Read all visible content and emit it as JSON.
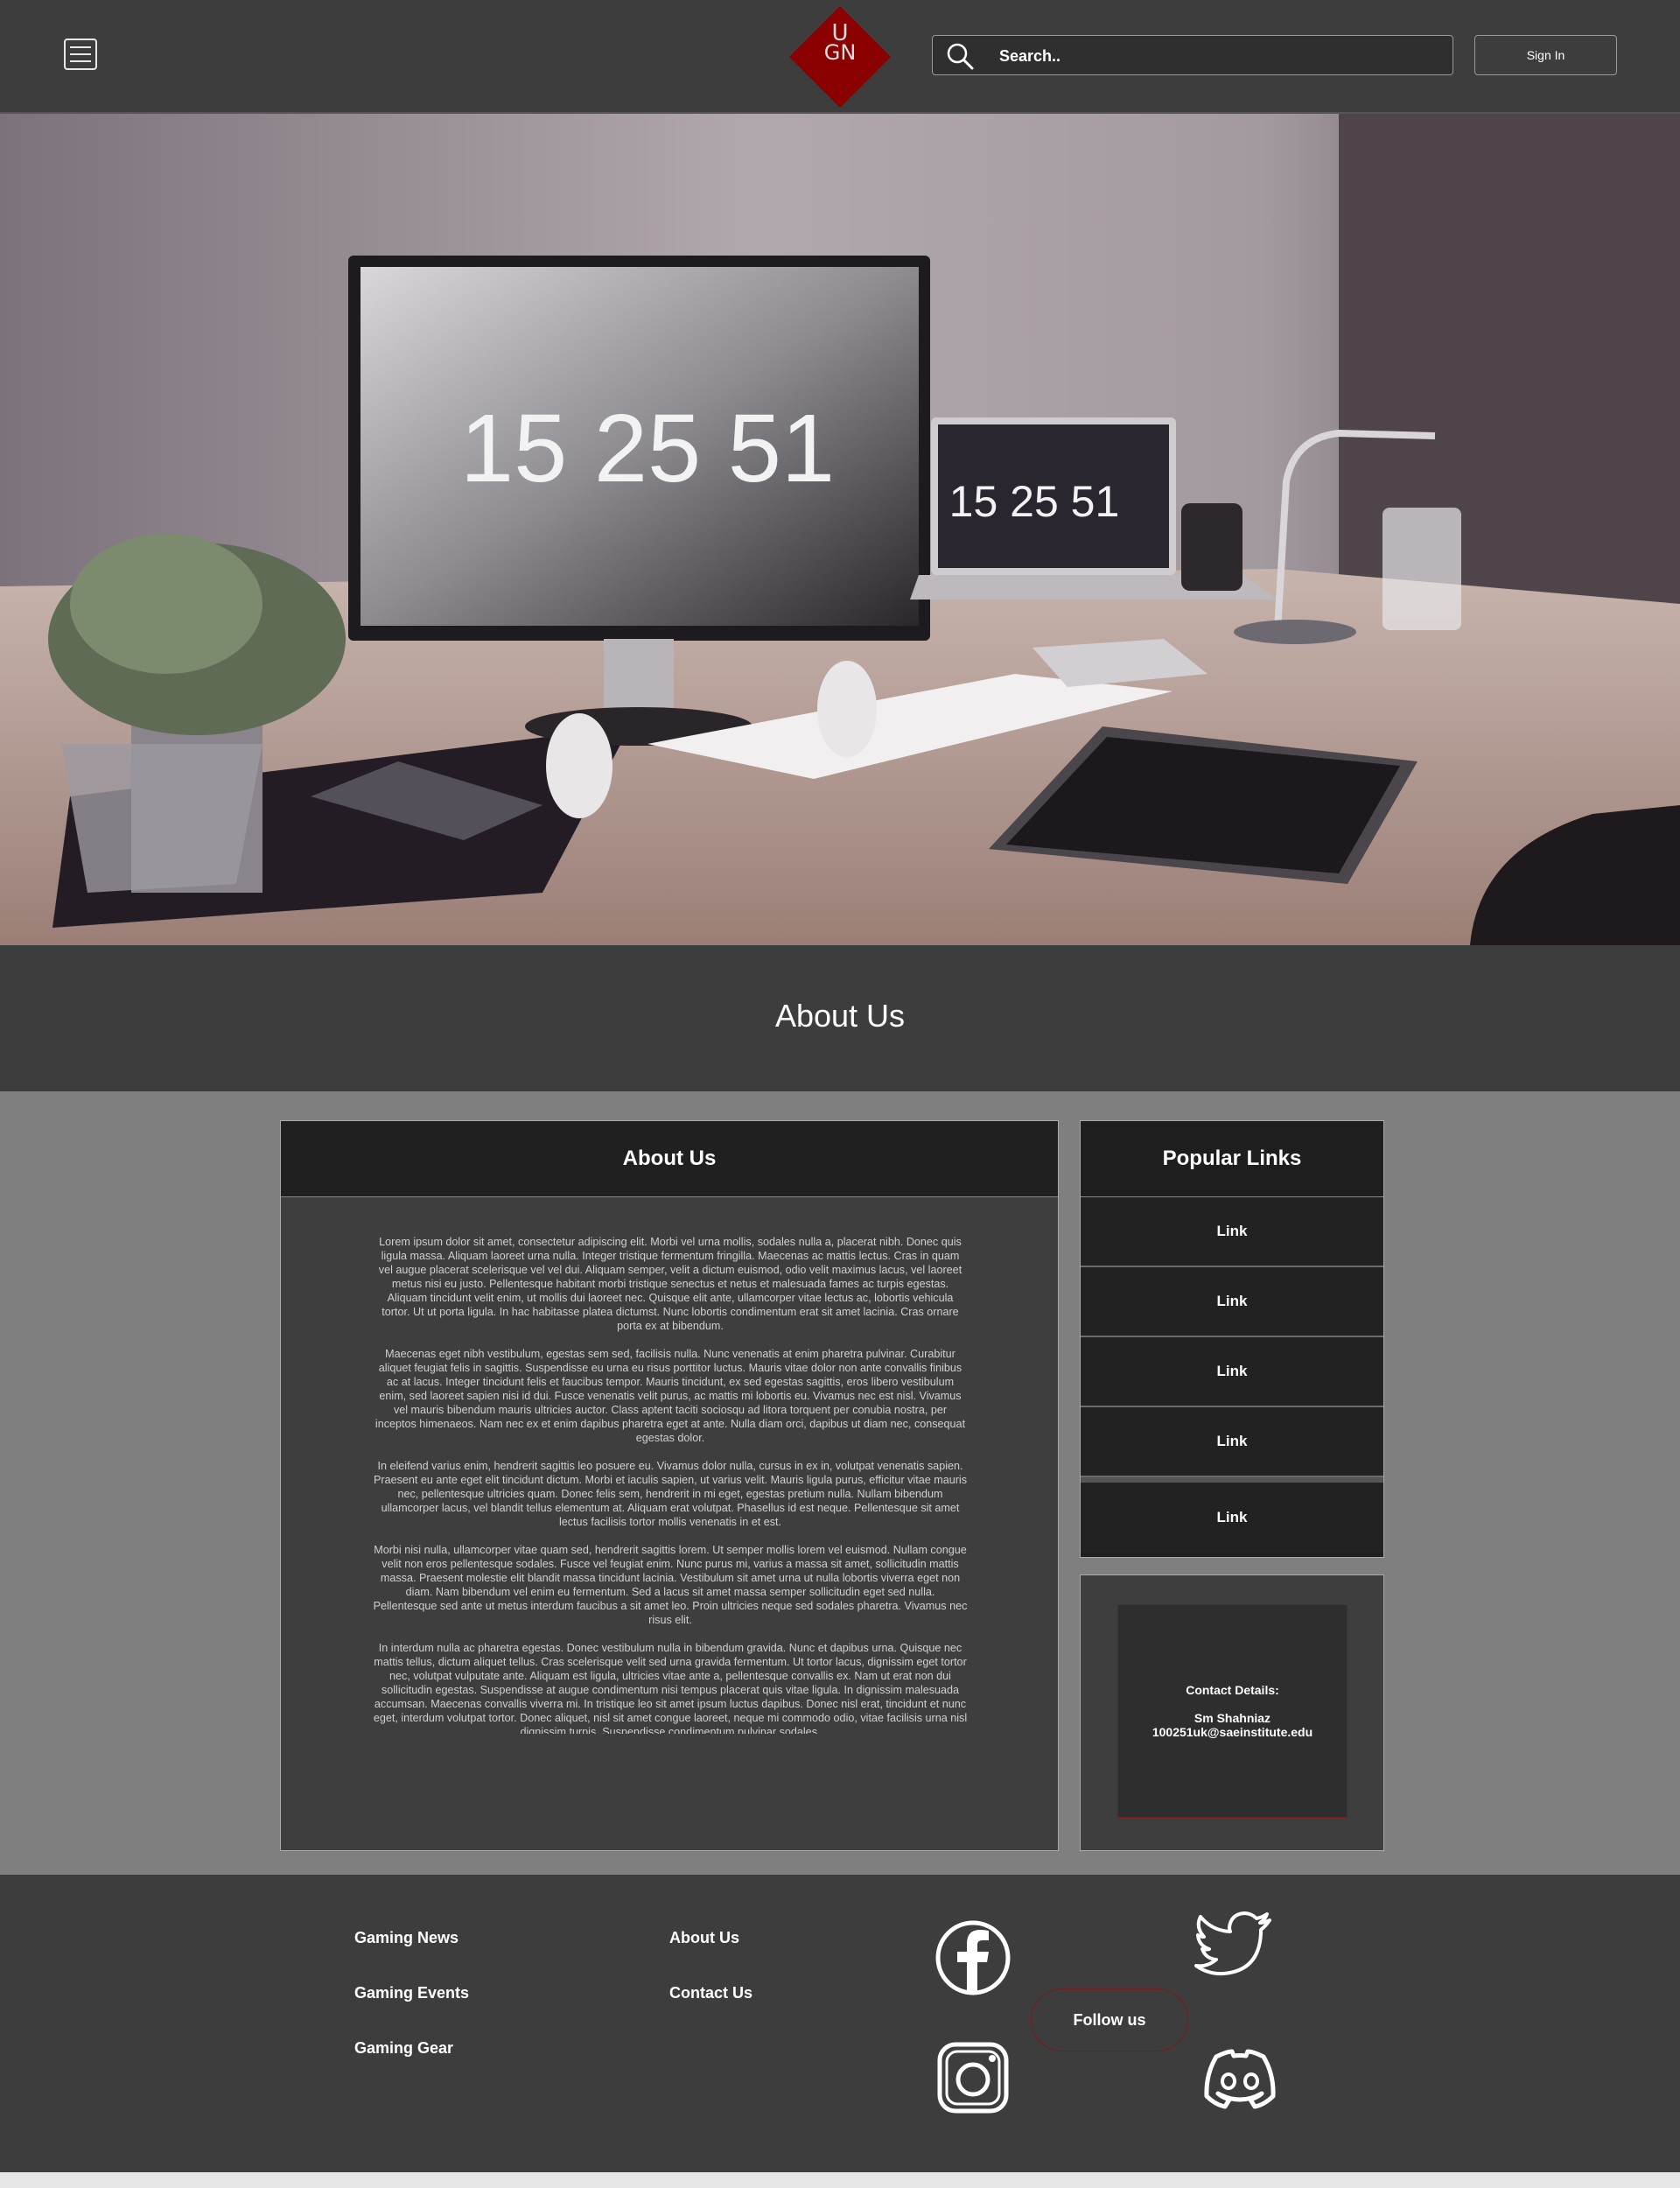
{
  "header": {
    "menu_icon": "hamburger-menu-icon",
    "logo": {
      "line1": "U",
      "line2": "GN",
      "color": "#8b0000"
    },
    "search": {
      "placeholder": "Search..",
      "icon": "search-icon"
    },
    "signin_label": "Sign In"
  },
  "hero": {
    "monitor_time": "15 25 51",
    "laptop_time": "15 25 51"
  },
  "about_band": {
    "title": "About Us"
  },
  "main_card": {
    "title": "About Us",
    "paragraphs": [
      "Lorem ipsum dolor sit amet, consectetur adipiscing elit. Morbi vel urna mollis, sodales nulla a, placerat nibh. Donec quis ligula massa. Aliquam laoreet urna nulla. Integer tristique fermentum fringilla. Maecenas ac mattis lectus. Cras in quam vel augue placerat scelerisque vel vel dui. Aliquam semper, velit a dictum euismod, odio velit maximus lacus, vel laoreet metus nisi eu justo. Pellentesque habitant morbi tristique senectus et netus et malesuada fames ac turpis egestas. Aliquam tincidunt velit enim, ut mollis dui laoreet nec. Quisque elit ante, ullamcorper vitae lectus ac, lobortis vehicula tortor. Ut ut porta ligula. In hac habitasse platea dictumst. Nunc lobortis condimentum erat sit amet lacinia. Cras ornare porta ex at bibendum.",
      "Maecenas eget nibh vestibulum, egestas sem sed, facilisis nulla. Nunc venenatis at enim pharetra pulvinar. Curabitur aliquet feugiat felis in sagittis. Suspendisse eu urna eu risus porttitor luctus. Mauris vitae dolor non ante convallis finibus ac at lacus. Integer tincidunt felis et faucibus tempor. Mauris tincidunt, ex sed egestas sagittis, eros libero vestibulum enim, sed laoreet sapien nisi id dui. Fusce venenatis velit purus, ac mattis mi lobortis eu. Vivamus nec est nisl. Vivamus vel mauris bibendum mauris ultricies auctor. Class aptent taciti sociosqu ad litora torquent per conubia nostra, per inceptos himenaeos. Nam nec ex et enim dapibus pharetra eget at ante. Nulla diam orci, dapibus ut diam nec, consequat egestas dolor.",
      "In eleifend varius enim, hendrerit sagittis leo posuere eu. Vivamus dolor nulla, cursus in ex in, volutpat venenatis sapien. Praesent eu ante eget elit tincidunt dictum. Morbi et iaculis sapien, ut varius velit. Mauris ligula purus, efficitur vitae mauris nec, pellentesque ultricies quam. Donec felis sem, hendrerit in mi eget, egestas pretium nulla. Nullam bibendum ullamcorper lacus, vel blandit tellus elementum at. Aliquam erat volutpat. Phasellus id est neque. Pellentesque sit amet lectus facilisis tortor mollis venenatis in et est.",
      "Morbi nisi nulla, ullamcorper vitae quam sed, hendrerit sagittis lorem. Ut semper mollis lorem vel euismod. Nullam congue velit non eros pellentesque sodales. Fusce vel feugiat enim. Nunc purus mi, varius a massa sit amet, sollicitudin mattis massa. Praesent molestie elit blandit massa tincidunt lacinia. Vestibulum sit amet urna ut nulla lobortis viverra eget non diam. Nam bibendum vel enim eu fermentum. Sed a lacus sit amet massa semper sollicitudin eget sed nulla. Pellentesque sed ante ut metus interdum faucibus a sit amet leo. Proin ultricies neque sed sodales pharetra. Vivamus nec risus elit.",
      "In interdum nulla ac pharetra egestas. Donec vestibulum nulla in bibendum gravida. Nunc et dapibus urna. Quisque nec mattis tellus, dictum aliquet tellus. Cras scelerisque velit sed urna gravida fermentum. Ut tortor lacus, dignissim eget tortor nec, volutpat vulputate ante. Aliquam est ligula, ultricies vitae ante a, pellentesque convallis ex. Nam ut erat non dui sollicitudin egestas. Suspendisse at augue condimentum nisi tempus placerat quis vitae ligula. In dignissim malesuada accumsan. Maecenas convallis viverra mi. In tristique leo sit amet ipsum luctus dapibus. Donec nisl erat, tincidunt et nunc eget, interdum volutpat tortor. Donec aliquet, nisl sit amet congue laoreet, neque mi commodo odio, vitae facilisis urna nisl dignissim turpis. Suspendisse condimentum pulvinar sodales."
    ]
  },
  "popular_links": {
    "title": "Popular Links",
    "items": [
      "Link",
      "Link",
      "Link",
      "Link",
      "Link"
    ]
  },
  "contact": {
    "title": "Contact Details:",
    "name": "Sm Shahniaz",
    "email": "100251uk@saeinstitute.edu"
  },
  "footer": {
    "col1": [
      "Gaming News",
      "Gaming Events",
      "Gaming Gear"
    ],
    "col2": [
      "About Us",
      "Contact Us"
    ],
    "follow_label": "Follow us",
    "social_icons": [
      "facebook-icon",
      "twitter-icon",
      "instagram-icon",
      "discord-icon"
    ]
  },
  "colors": {
    "header_bg": "#3d3d3d",
    "content_bg": "#7f7f7f",
    "card_head_bg": "#202020",
    "accent": "#8b0000"
  }
}
